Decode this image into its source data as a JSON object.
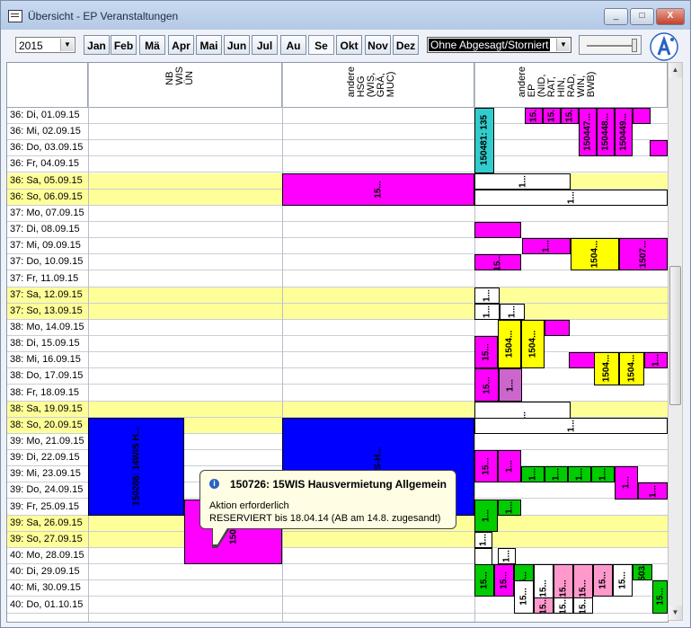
{
  "window": {
    "title": "Übersicht - EP Veranstaltungen",
    "minimize": "_",
    "maximize": "□",
    "close": "X"
  },
  "toolbar": {
    "year": "2015",
    "months": [
      "Jan",
      "Feb",
      "Mä",
      "Apr",
      "Mai",
      "Jun",
      "Jul",
      "Au",
      "Se",
      "Okt",
      "Nov",
      "Dez"
    ],
    "active_month": "Se",
    "filter": "Ohne Abgesagt/Storniert",
    "logo": "accentur"
  },
  "columns": [
    {
      "header": "NB\nWIS\nÜN"
    },
    {
      "header": "andere\nHSG\n(WIS,\nGRÄ,\nMUC)"
    },
    {
      "header": "andere\nEP\n(NID,\nRAT,\nHIN,\nRAD,\nWIN,\nBWB)"
    }
  ],
  "rows": [
    {
      "label": "36: Di, 01.09.15",
      "we": false
    },
    {
      "label": "36: Mi, 02.09.15",
      "we": false
    },
    {
      "label": "36: Do, 03.09.15",
      "we": false
    },
    {
      "label": "36: Fr, 04.09.15",
      "we": false
    },
    {
      "label": "36: Sa, 05.09.15",
      "we": true
    },
    {
      "label": "36: So, 06.09.15",
      "we": true
    },
    {
      "label": "37: Mo, 07.09.15",
      "we": false
    },
    {
      "label": "37: Di, 08.09.15",
      "we": false
    },
    {
      "label": "37: Mi, 09.09.15",
      "we": false
    },
    {
      "label": "37: Do, 10.09.15",
      "we": false
    },
    {
      "label": "37: Fr, 11.09.15",
      "we": false
    },
    {
      "label": "37: Sa, 12.09.15",
      "we": true
    },
    {
      "label": "37: So, 13.09.15",
      "we": true
    },
    {
      "label": "38: Mo, 14.09.15",
      "we": false
    },
    {
      "label": "38: Di, 15.09.15",
      "we": false
    },
    {
      "label": "38: Mi, 16.09.15",
      "we": false
    },
    {
      "label": "38: Do, 17.09.15",
      "we": false
    },
    {
      "label": "38: Fr, 18.09.15",
      "we": false
    },
    {
      "label": "38: Sa, 19.09.15",
      "we": true
    },
    {
      "label": "38: So, 20.09.15",
      "we": true
    },
    {
      "label": "39: Mo, 21.09.15",
      "we": false
    },
    {
      "label": "39: Di, 22.09.15",
      "we": false
    },
    {
      "label": "39: Mi, 23.09.15",
      "we": false
    },
    {
      "label": "39: Do, 24.09.15",
      "we": false
    },
    {
      "label": "39: Fr, 25.09.15",
      "we": false
    },
    {
      "label": "39: Sa, 26.09.15",
      "we": true
    },
    {
      "label": "39: So, 27.09.15",
      "we": true
    },
    {
      "label": "40: Mo, 28.09.15",
      "we": false
    },
    {
      "label": "40: Di, 29.09.15",
      "we": false
    },
    {
      "label": "40: Mi, 30.09.15",
      "we": false
    },
    {
      "label": "40: Do, 01.10.15",
      "we": false
    }
  ],
  "bookings": {
    "cyan": "150481: 135",
    "magenta_a": "15.",
    "magenta_b": "150447...",
    "magenta_c": "150448...",
    "magenta_d": "150449...",
    "hsg_sat": "15...",
    "yellow_a": "1504...",
    "yellow_b": "1507...",
    "yellow_c": "1504...",
    "yellow_d": "1504...",
    "blue_nb": "150286: 14WIS H...",
    "blue_hsg": "6WIS-H...",
    "mag_nb": "15072",
    "short": "15...",
    "short2": "1...",
    "short3": "1503..."
  },
  "tooltip": {
    "icon": "i",
    "title": "150726: 15WIS Hausvermietung Allgemein",
    "line1": "Aktion erforderlich",
    "line2": "RESERVIERT bis 18.04.14 (AB am 14.8. zugesandt)"
  },
  "colors": {
    "magenta": "#ff00ff",
    "yellow": "#ffff00",
    "cyan": "#33cccc",
    "blue": "#0000ff",
    "green": "#00cc00",
    "pink": "#ff99cc",
    "violet": "#cc66cc",
    "weekend": "#ffff99"
  }
}
